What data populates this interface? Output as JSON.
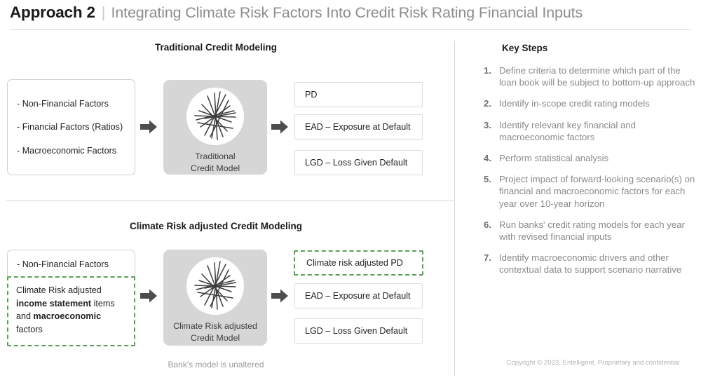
{
  "header": {
    "main_title": "Approach 2",
    "separator": "|",
    "subtitle": "Integrating Climate Risk Factors Into Credit Risk Rating Financial Inputs"
  },
  "top_section": {
    "title": "Traditional  Credit Modeling",
    "inputs": [
      "-  Non-Financial Factors",
      "- Financial Factors (Ratios)",
      "- Macroeconomic Factors"
    ],
    "model": {
      "line1": "Traditional",
      "line2": "Credit Model",
      "icon": "scribble-network-icon"
    },
    "arrow1": "arrow-right-icon",
    "arrow2": "arrow-right-icon",
    "outputs": [
      {
        "label": "PD",
        "highlighted": false
      },
      {
        "label": "EAD – Exposure at Default",
        "highlighted": false
      },
      {
        "label": "LGD – Loss Given Default",
        "highlighted": false
      }
    ]
  },
  "bottom_section": {
    "title": "Climate Risk adjusted Credit Modeling",
    "input_plain": "-  Non-Financial Factors",
    "input_highlighted": {
      "part1": "Climate Risk adjusted ",
      "bold1": "income statement",
      "part2": " items and ",
      "bold2": "macroeconomic",
      "part3": " factors"
    },
    "model": {
      "line1": "Climate Risk adjusted",
      "line2": "Credit Model",
      "icon": "scribble-network-icon"
    },
    "arrow1": "arrow-right-icon",
    "arrow2": "arrow-right-icon",
    "outputs": [
      {
        "label": "Climate risk adjusted PD",
        "highlighted": true
      },
      {
        "label": "EAD – Exposure at Default",
        "highlighted": false
      },
      {
        "label": "LGD – Loss Given Default",
        "highlighted": false
      }
    ],
    "caption": "Bank's model is unaltered"
  },
  "key_steps": {
    "title": "Key Steps",
    "items": [
      {
        "num": "1.",
        "text": "Define criteria to determine which part of the loan book will be subject to bottom-up approach"
      },
      {
        "num": "2.",
        "text": "Identify in-scope credit rating models"
      },
      {
        "num": "3.",
        "text": "Identify relevant key financial and macroeconomic factors"
      },
      {
        "num": "4.",
        "text": "Perform statistical analysis"
      },
      {
        "num": "5.",
        "text": "Project impact of forward-looking scenario(s) on financial and macroeconomic factors for each year over 10-year horizon"
      },
      {
        "num": "6.",
        "text": "Run banks' credit rating models for each year with revised financial inputs"
      },
      {
        "num": "7.",
        "text": "Identify macroeconomic drivers and other contextual data to support scenario narrative"
      }
    ]
  },
  "footer": {
    "copyright": "Copyright © 2023, Entelligent, Proprietary and confidential"
  },
  "colors": {
    "accent_green": "#5aa05a",
    "model_gray": "#d6d6d6",
    "arrow_gray": "#4d4d4d",
    "muted_text": "#8a8a8a"
  }
}
